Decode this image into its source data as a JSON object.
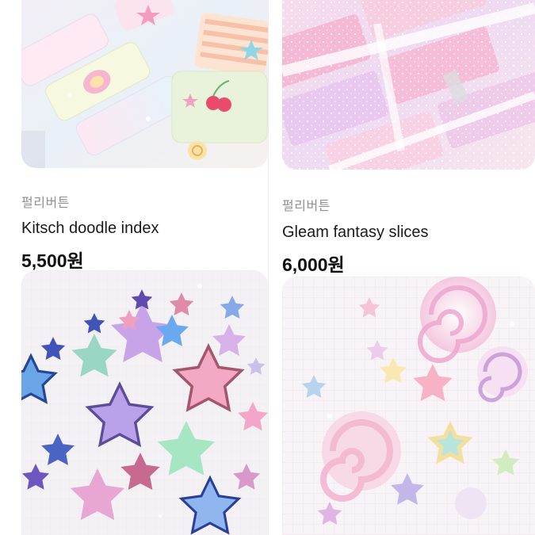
{
  "products": [
    {
      "seller": "펄리버튼",
      "title": "Kitsch doodle index",
      "price": "5,500원",
      "image_icon": "index-sticker-image"
    },
    {
      "seller": "펄리버튼",
      "title": "Gleam fantasy slices",
      "price": "6,000원",
      "image_icon": "glitter-sticker-image"
    },
    {
      "image_icon": "star-sticker-image"
    },
    {
      "image_icon": "candy-swirl-sticker-image"
    }
  ],
  "colors": {
    "price": "#111111",
    "seller": "#8f8f8f",
    "title": "#1a1a1a",
    "divider": "#ececec"
  }
}
